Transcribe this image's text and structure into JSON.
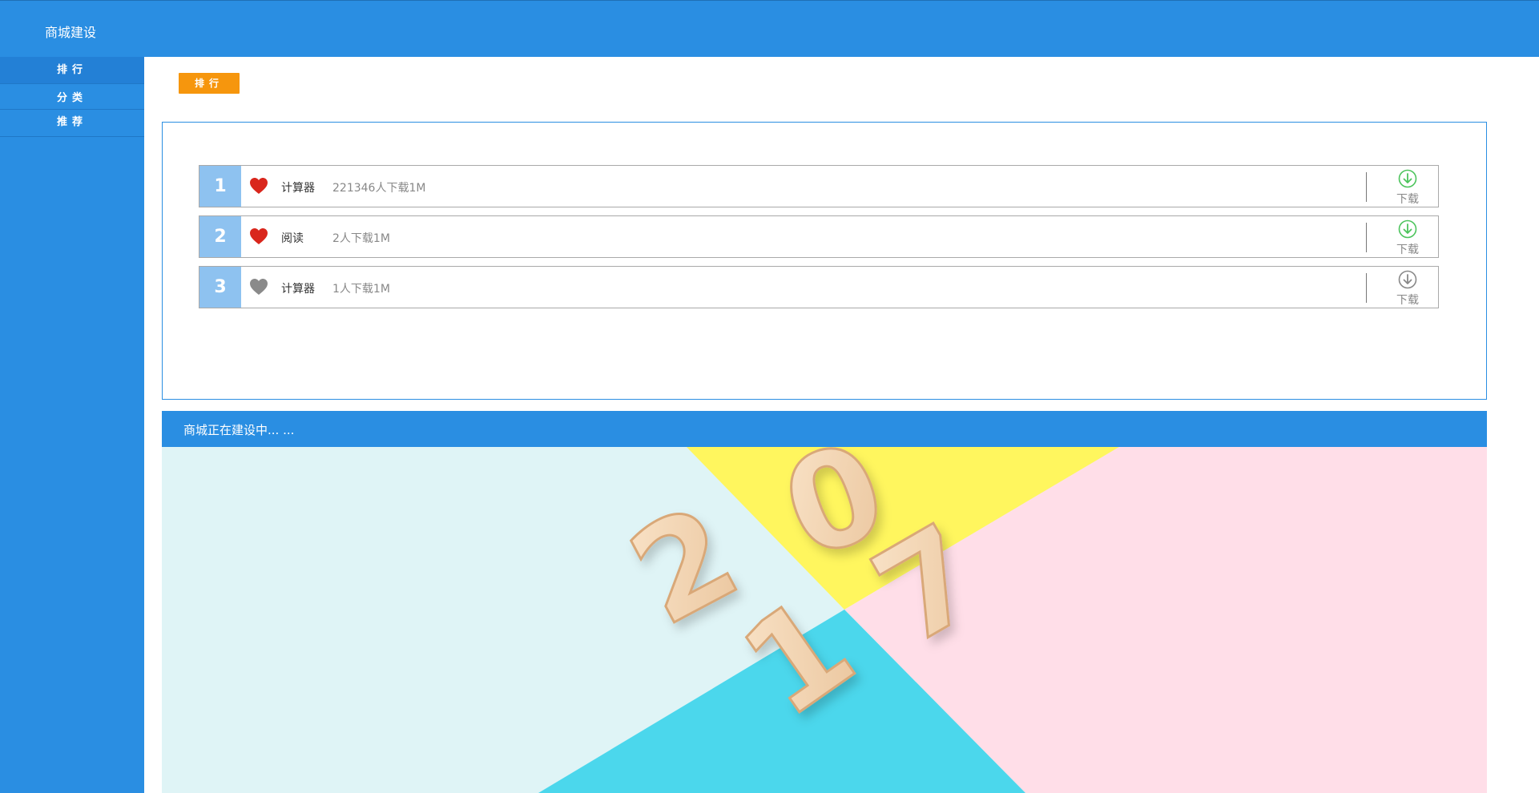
{
  "header": {
    "title": "商城建设"
  },
  "sidebar": {
    "items": [
      {
        "label": "排行",
        "active": true
      },
      {
        "label": "分类",
        "active": false
      },
      {
        "label": "推荐",
        "active": false
      }
    ]
  },
  "main": {
    "tag_button": "排行",
    "rankings": [
      {
        "rank": "1",
        "name": "计算器",
        "meta": "221346人下载1M",
        "favorited": true,
        "download_label": "下载",
        "download_color": "#4cc45c"
      },
      {
        "rank": "2",
        "name": "阅读",
        "meta": "2人下载1M",
        "favorited": true,
        "download_label": "下载",
        "download_color": "#4cc45c"
      },
      {
        "rank": "3",
        "name": "计算器",
        "meta": "1人下载1M",
        "favorited": false,
        "download_label": "下载",
        "download_color": "#888888"
      }
    ],
    "banner": {
      "title": "商城正在建设中... ...",
      "year_digits": [
        "2",
        "0",
        "1",
        "7"
      ]
    }
  },
  "colors": {
    "primary": "#2a8ee2",
    "accent": "#f6960d",
    "rank_bg": "#8ec2f0",
    "heart_active": "#d9261c",
    "heart_inactive": "#8a8a8a"
  }
}
